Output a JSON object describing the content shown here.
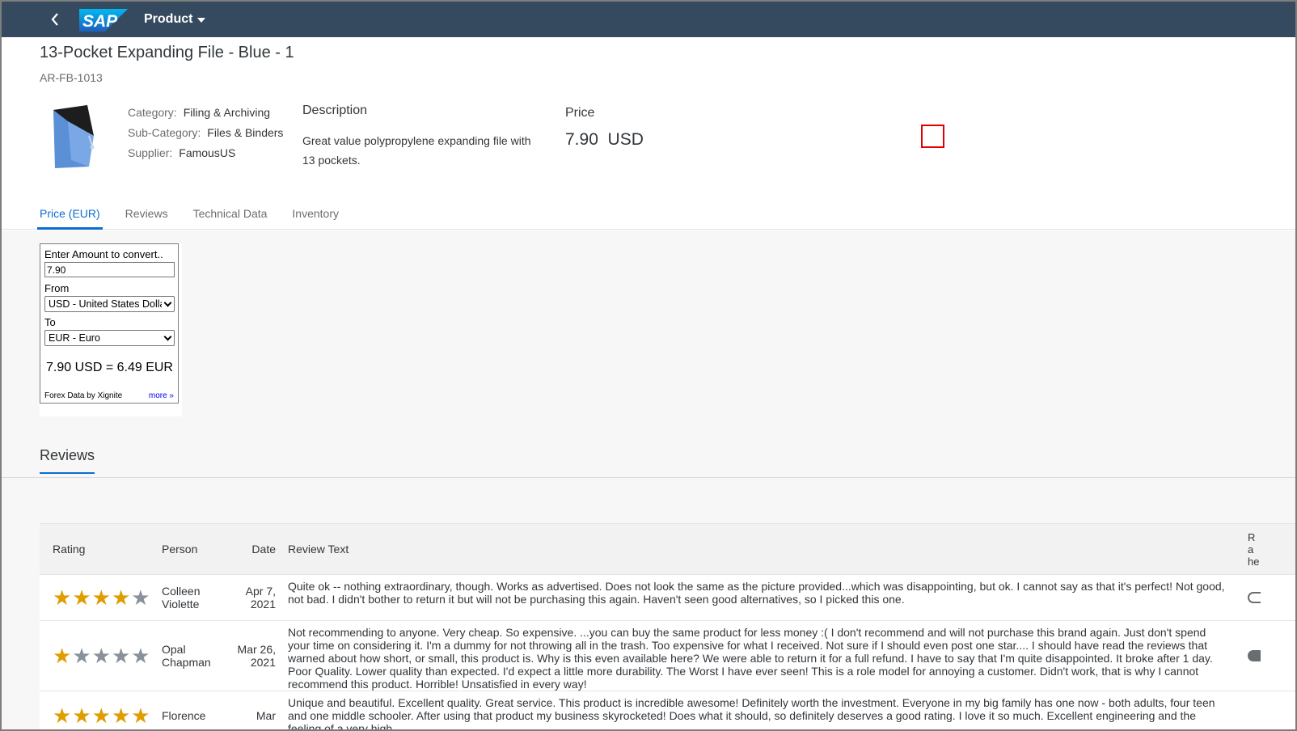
{
  "shell": {
    "logo_text": "SAP",
    "app_title": "Product"
  },
  "header": {
    "title": "13-Pocket Expanding File - Blue - 1",
    "subtitle": "AR-FB-1013",
    "attributes": [
      {
        "label": "Category:",
        "value": "Filing & Archiving"
      },
      {
        "label": "Sub-Category:",
        "value": "Files & Binders"
      },
      {
        "label": "Supplier:",
        "value": "FamousUS"
      }
    ],
    "description_title": "Description",
    "description_text": "Great value polypropylene expanding file with 13 pockets.",
    "price_title": "Price",
    "price_value": "7.90  USD"
  },
  "tabs": [
    {
      "label": "Price (EUR)",
      "active": true
    },
    {
      "label": "Reviews",
      "active": false
    },
    {
      "label": "Technical Data",
      "active": false
    },
    {
      "label": "Inventory",
      "active": false
    }
  ],
  "converter": {
    "amount_label": "Enter Amount to convert..",
    "amount_value": "7.90",
    "from_label": "From",
    "from_value": "USD - United States Dollar",
    "to_label": "To",
    "to_value": "EUR - Euro",
    "result": "7.90 USD = 6.49 EUR",
    "footer_left": "Forex Data by Xignite",
    "footer_more": "more »"
  },
  "reviews": {
    "section_title": "Reviews",
    "columns": {
      "rating": "Rating",
      "person": "Person",
      "date": "Date",
      "text": "Review Text",
      "helpful": "Ra he"
    },
    "rows": [
      {
        "rating": 4,
        "person": "Colleen Violette",
        "date": "Apr 7, 2021",
        "text": "Quite ok -- nothing extraordinary, though. Works as advertised. Does not look the same as the picture provided...which was disappointing, but ok. I cannot say as that it's perfect! Not good, not bad. I didn't bother to return it but will not be purchasing this again. Haven't seen good alternatives, so I picked this one."
      },
      {
        "rating": 1,
        "person": "Opal Chapman",
        "date": "Mar 26, 2021",
        "text": "Not recommending to anyone. Very cheap. So expensive. ...you can buy the same product for less money :( I don't recommend and will not purchase this brand again. Just don't spend your time on considering it. I'm a dummy for not throwing all in the trash. Too expensive for what I received. Not sure if I should even post one star.... I should have read the reviews that warned about how short, or small, this product is. Why is this even available here? We were able to return it for a full refund. I have to say that I'm quite disappointed. It broke after 1 day. Poor Quality. Lower quality than expected. I'd expect a little more durability. The Worst I have ever seen! This is a role model for annoying a customer. Didn't work, that is why I cannot recommend this product. Horrible! Unsatisfied in every way!"
      },
      {
        "rating": 5,
        "person": "Florence",
        "date": "Mar",
        "text": "Unique and beautiful. Excellent quality. Great service. This product is incredible awesome! Definitely worth the investment. Everyone in my big family has one now - both adults, four teen and one middle schooler. After using that product my business skyrocketed! Does what it should, so definitely deserves a good rating. I love it so much. Excellent engineering and the feeling of a very high"
      }
    ]
  },
  "colors": {
    "shell": "#354a5f",
    "accent": "#0a6ed1",
    "star_on": "#e09d00",
    "star_off": "#89919a",
    "highlight_box": "#e00000"
  }
}
